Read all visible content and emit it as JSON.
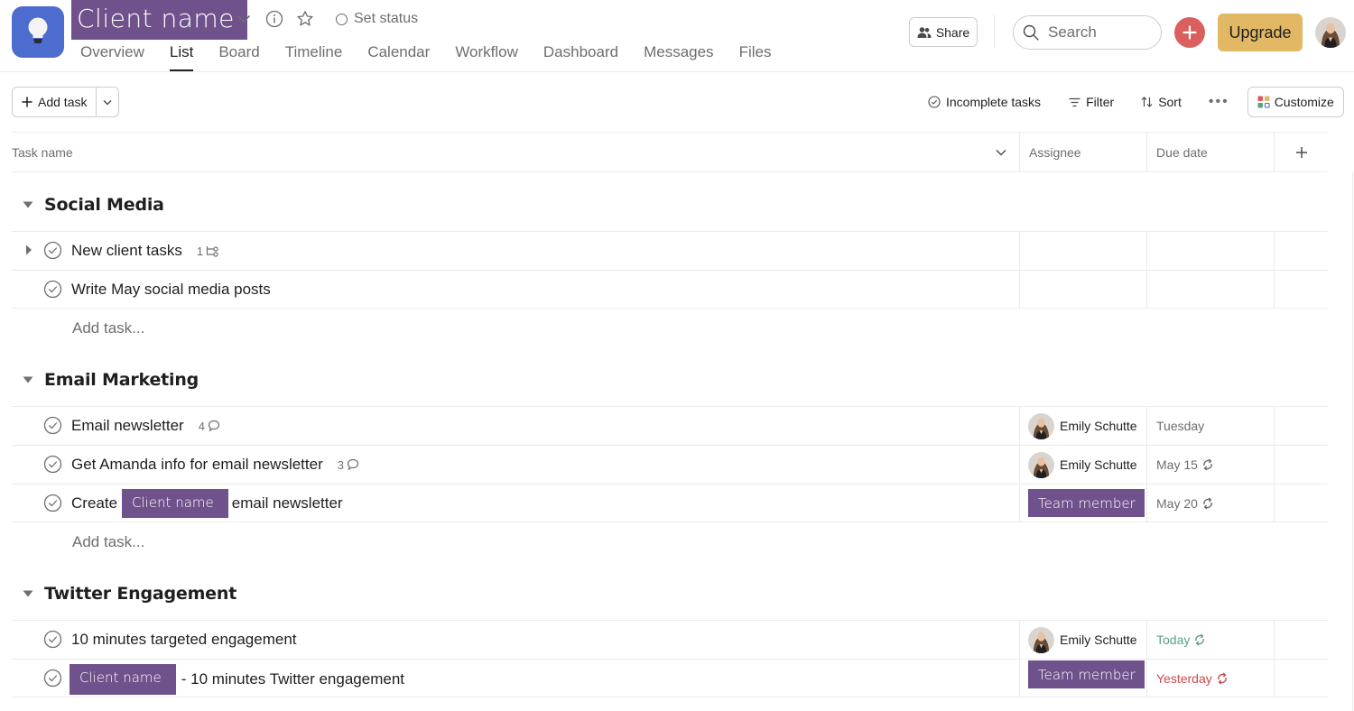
{
  "header": {
    "project_title": "Client name",
    "set_status_label": "Set status",
    "tabs": [
      {
        "label": "Overview",
        "active": false
      },
      {
        "label": "List",
        "active": true
      },
      {
        "label": "Board",
        "active": false
      },
      {
        "label": "Timeline",
        "active": false
      },
      {
        "label": "Calendar",
        "active": false
      },
      {
        "label": "Workflow",
        "active": false
      },
      {
        "label": "Dashboard",
        "active": false
      },
      {
        "label": "Messages",
        "active": false
      },
      {
        "label": "Files",
        "active": false
      }
    ],
    "share_label": "Share",
    "search_placeholder": "Search",
    "upgrade_label": "Upgrade"
  },
  "toolbar": {
    "add_task_label": "Add task",
    "incomplete_tasks_label": "Incomplete tasks",
    "filter_label": "Filter",
    "sort_label": "Sort",
    "more_label": "•••",
    "customize_label": "Customize"
  },
  "columns": {
    "task_name": "Task name",
    "assignee": "Assignee",
    "due_date": "Due date"
  },
  "colors": {
    "brand_project": "#4c6ccf",
    "tag_purple": "#6f528c",
    "create_button": "#d9605e",
    "upgrade": "#e2b864",
    "due_today": "#58a182",
    "due_overdue": "#c9484e"
  },
  "sections": [
    {
      "name": "Social Media",
      "add_task_label": "Add task...",
      "tasks": [
        {
          "name": "New client tasks",
          "subtasks": "1",
          "has_expander": true
        },
        {
          "name": "Write May social media posts"
        }
      ]
    },
    {
      "name": "Email Marketing",
      "add_task_label": "Add task...",
      "tasks": [
        {
          "name": "Email newsletter",
          "comments": "4",
          "assignee": "Emily Schutte",
          "due": "Tuesday"
        },
        {
          "name": "Get Amanda info for email newsletter",
          "comments": "3",
          "assignee": "Emily Schutte",
          "due": "May 15",
          "recurring": true
        },
        {
          "name_prefix": "Create",
          "client_tag": "Client name",
          "name_suffix": "email newsletter",
          "assignee_tag": "Team member",
          "due": "May 20",
          "recurring": true
        }
      ]
    },
    {
      "name": "Twitter Engagement",
      "tasks": [
        {
          "name": "10 minutes targeted engagement",
          "assignee": "Emily Schutte",
          "due": "Today",
          "due_state": "today",
          "recurring": true
        },
        {
          "client_tag": "Client name",
          "name_suffix": "- 10 minutes Twitter engagement",
          "assignee_tag": "Team member",
          "due": "Yesterday",
          "due_state": "overdue",
          "recurring": true
        }
      ]
    }
  ]
}
